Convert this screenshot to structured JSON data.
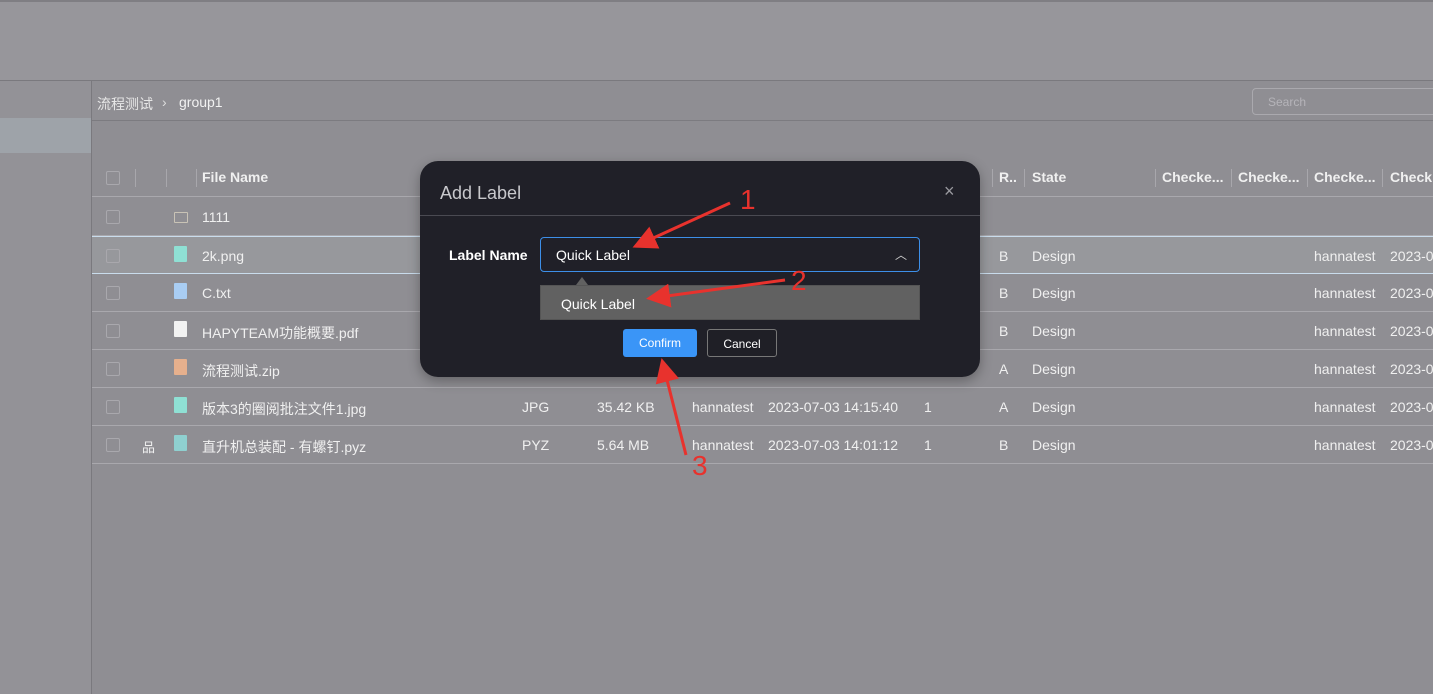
{
  "breadcrumb": {
    "root": "流程测试",
    "current": "group1"
  },
  "search": {
    "placeholder": "Search"
  },
  "table": {
    "headers": {
      "name": "File Name",
      "r": "R..",
      "state": "State",
      "c1": "Checke...",
      "c2": "Checke...",
      "c3": "Checke...",
      "c4": "Check"
    },
    "rows": [
      {
        "name": "1111",
        "icon": "folder-icon",
        "type": "",
        "size": "",
        "owner": "",
        "date": "",
        "ver": "",
        "r": "",
        "state": "",
        "checker": "",
        "checkdate": ""
      },
      {
        "name": "2k.png",
        "icon": "image-file-icon",
        "type": "",
        "size": "",
        "owner": "",
        "date": "",
        "ver": "",
        "r": "B",
        "state": "Design",
        "checker": "hannatest",
        "checkdate": "2023-0"
      },
      {
        "name": "C.txt",
        "icon": "text-file-icon",
        "type": "",
        "size": "",
        "owner": "",
        "date": "",
        "ver": "",
        "r": "B",
        "state": "Design",
        "checker": "hannatest",
        "checkdate": "2023-0"
      },
      {
        "name": "HAPYTEAM功能概要.pdf",
        "icon": "pdf-file-icon",
        "type": "",
        "size": "",
        "owner": "",
        "date": "",
        "ver": "",
        "r": "B",
        "state": "Design",
        "checker": "hannatest",
        "checkdate": "2023-0"
      },
      {
        "name": "流程测试.zip",
        "icon": "zip-file-icon",
        "type": "",
        "size": "",
        "owner": "",
        "date": "",
        "ver": "",
        "r": "A",
        "state": "Design",
        "checker": "hannatest",
        "checkdate": "2023-0"
      },
      {
        "name": "版本3的圈阅批注文件1.jpg",
        "icon": "image-file-icon",
        "type": "JPG",
        "size": "35.42 KB",
        "owner": "hannatest",
        "date": "2023-07-03 14:15:40",
        "ver": "1",
        "r": "A",
        "state": "Design",
        "checker": "hannatest",
        "checkdate": "2023-0"
      },
      {
        "name": "直升机总装配 - 有螺钉.pyz",
        "icon": "3d-model-icon",
        "type": "PYZ",
        "size": "5.64 MB",
        "owner": "hannatest",
        "date": "2023-07-03 14:01:12",
        "ver": "1",
        "r": "B",
        "state": "Design",
        "checker": "hannatest",
        "checkdate": "2023-0"
      }
    ]
  },
  "modal": {
    "title": "Add Label",
    "label_name": "Label Name",
    "value": "Quick Label",
    "options": [
      "Quick Label"
    ],
    "confirm": "Confirm",
    "cancel": "Cancel",
    "close": "×"
  },
  "annotations": {
    "n1": "1",
    "n2": "2",
    "n3": "3",
    "color": "#e8322d"
  },
  "colors": {
    "accent": "#3a95f7",
    "modal_bg": "#202028"
  }
}
